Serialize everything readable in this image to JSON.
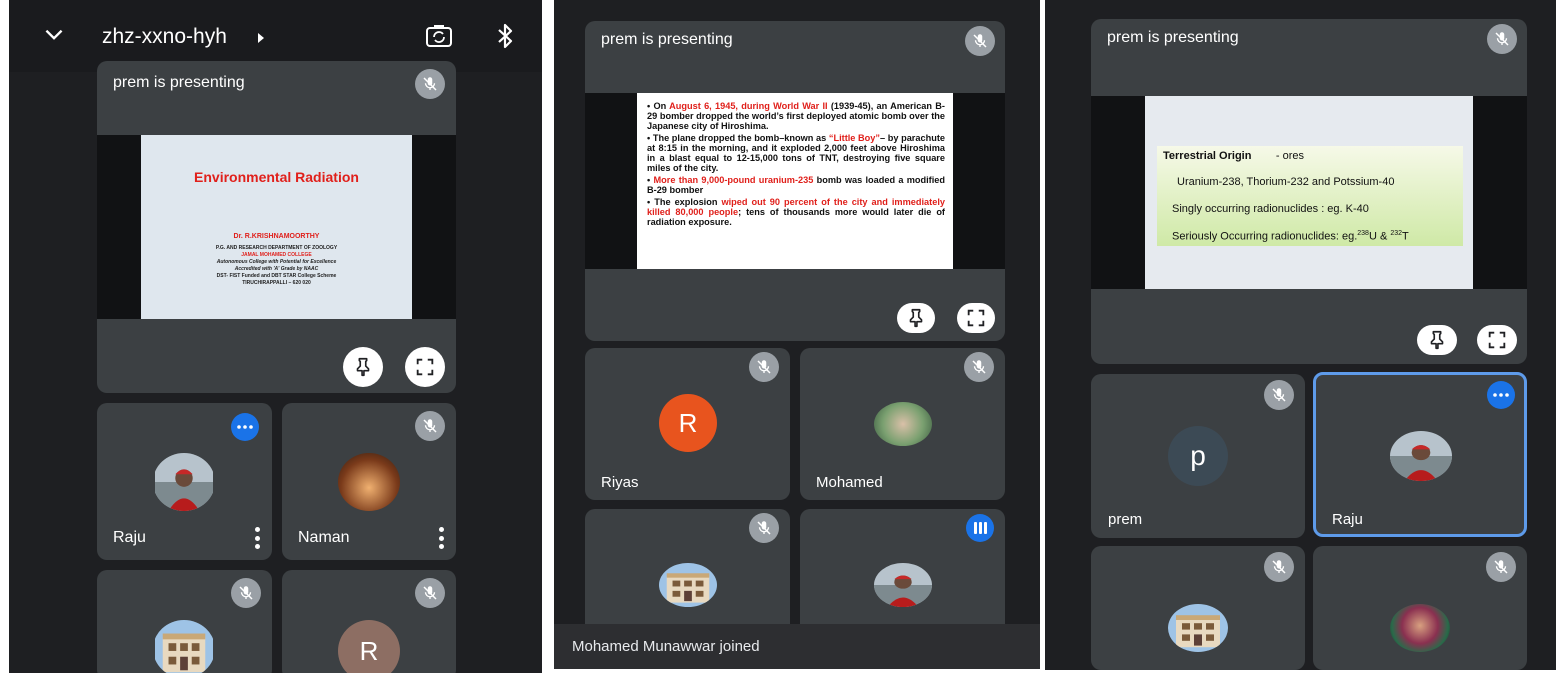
{
  "panel1": {
    "meeting_code": "zhz-xxno-hyh",
    "presenter_label": "prem is presenting",
    "slide": {
      "title": "Environmental Radiation",
      "author": "Dr. R.KRISHNAMOORTHY",
      "lines": [
        "P.G. AND RESEARCH DEPARTMENT OF ZOOLOGY",
        "JAMAL MOHAMED COLLEGE",
        "Autonomous College with Potential for Excellence",
        "Accredited with 'A' Grade by NAAC",
        "DST- FIST Funded and DBT STAR  College Scheme",
        "TIRUCHIRAPPALLI – 620 020"
      ]
    },
    "participants": [
      {
        "name": "Raju"
      },
      {
        "name": "Naman"
      },
      {
        "name": ""
      },
      {
        "name": "",
        "initial": "R"
      }
    ]
  },
  "panel2": {
    "presenter_label": "prem is presenting",
    "slide": {
      "b1_a": "On ",
      "b1_red": "August 6, 1945, during World War II",
      "b1_b": " (1939-45), an American B-29 bomber dropped the world’s first deployed atomic bomb over the Japanese city of Hiroshima.",
      "b2_a": "The plane dropped the bomb–known as ",
      "b2_red": "“Little Boy”",
      "b2_b": "– by parachute at 8:15 in the morning, and it exploded 2,000 feet above Hiroshima in a blast equal to 12-15,000 tons of TNT, destroying five square miles of the city.",
      "b3_red": "More than 9,000-pound uranium-235",
      "b3_b": " bomb was loaded a modified B-29 bomber",
      "b4_a": "The explosion ",
      "b4_red": "wiped out 90 percent of the city and immediately killed 80,000 people",
      "b4_b": "; tens of thousands more would later die of radiation exposure."
    },
    "participants": [
      {
        "name": "Riyas",
        "initial": "R"
      },
      {
        "name": "Mohamed"
      },
      {
        "name": ""
      },
      {
        "name": ""
      }
    ],
    "toast": "Mohamed Munawwar joined"
  },
  "panel3": {
    "presenter_label": "prem is presenting",
    "slide": {
      "heading": "Terrestrial Origin",
      "heading_suffix": "- ores",
      "line1": "Uranium-238, Thorium-232 and Potssium-40",
      "line2": "Singly occurring radionuclides : eg. K-40",
      "line3_a": "Seriously Occurring radionuclides: eg.",
      "sup1": "238",
      "line3_b": "U & ",
      "sup2": "232",
      "line3_c": "T"
    },
    "participants": [
      {
        "name": "prem",
        "initial": "p"
      },
      {
        "name": "Raju"
      },
      {
        "name": ""
      },
      {
        "name": ""
      }
    ]
  },
  "colors": {
    "background": "#1e1f22",
    "tile": "#3c4043",
    "accent_blue": "#1a73e8",
    "slide_red": "#e0201b",
    "riyas_avatar": "#e8541e",
    "prem_avatar": "#3c4a55",
    "r_avatar_panel1": "#8d6e63"
  },
  "icons": [
    "chevron-down-icon",
    "chevron-right-icon",
    "camera-flip-icon",
    "bluetooth-icon",
    "mic-off-icon",
    "pin-icon",
    "fullscreen-icon",
    "more-options-icon",
    "audio-level-icon"
  ]
}
